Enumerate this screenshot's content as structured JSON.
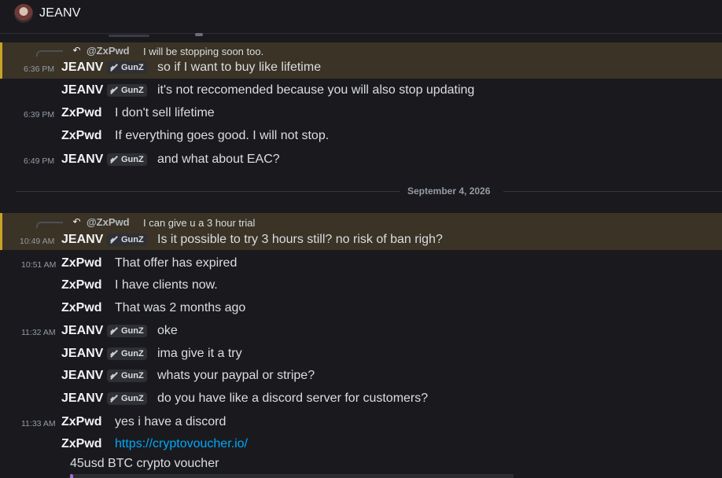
{
  "header": {
    "title": "JEANV"
  },
  "date_divider": "September 4, 2026",
  "tag_label": "GunZ",
  "messages": {
    "m1_reply": {
      "author": "@ZxPwd",
      "text": "I will be stopping soon too."
    },
    "m1": {
      "time": "6:36 PM",
      "author": "JEANV",
      "text": "so if I want to buy like lifetime"
    },
    "m2": {
      "author": "JEANV",
      "text": "it's not reccomended because you will also stop updating"
    },
    "m3": {
      "time": "6:39 PM",
      "author": "ZxPwd",
      "text": "I don't sell lifetime"
    },
    "m4": {
      "author": "ZxPwd",
      "text": "If everything goes good. I will not stop."
    },
    "m5": {
      "time": "6:49 PM",
      "author": "JEANV",
      "text": "and what about EAC?"
    },
    "m6_reply": {
      "author": "@ZxPwd",
      "text": "I can give u a 3 hour trial"
    },
    "m6": {
      "time": "10:49 AM",
      "author": "JEANV",
      "text": "Is it possible to try 3 hours still? no risk of ban righ?"
    },
    "m7": {
      "time": "10:51 AM",
      "author": "ZxPwd",
      "text": "That offer has expired"
    },
    "m8": {
      "author": "ZxPwd",
      "text": "I have clients now."
    },
    "m9": {
      "author": "ZxPwd",
      "text": "That was 2 months ago"
    },
    "m10": {
      "time": "11:32 AM",
      "author": "JEANV",
      "text": "oke"
    },
    "m11": {
      "author": "JEANV",
      "text": "ima give it a try"
    },
    "m12": {
      "author": "JEANV",
      "text": "whats your paypal or stripe?"
    },
    "m13": {
      "author": "JEANV",
      "text": "do you have like a discord server for customers?"
    },
    "m14": {
      "time": "11:33 AM",
      "author": "ZxPwd",
      "text": "yes i have a discord"
    },
    "m15": {
      "author": "ZxPwd",
      "text": "https://cryptovoucher.io/"
    },
    "m16": {
      "text": "45usd BTC crypto voucher"
    }
  },
  "colors": {
    "background": "#1a1a1e",
    "mention_highlight": "#3a3326",
    "mention_border": "#c9a227",
    "link": "#00a8fc"
  }
}
